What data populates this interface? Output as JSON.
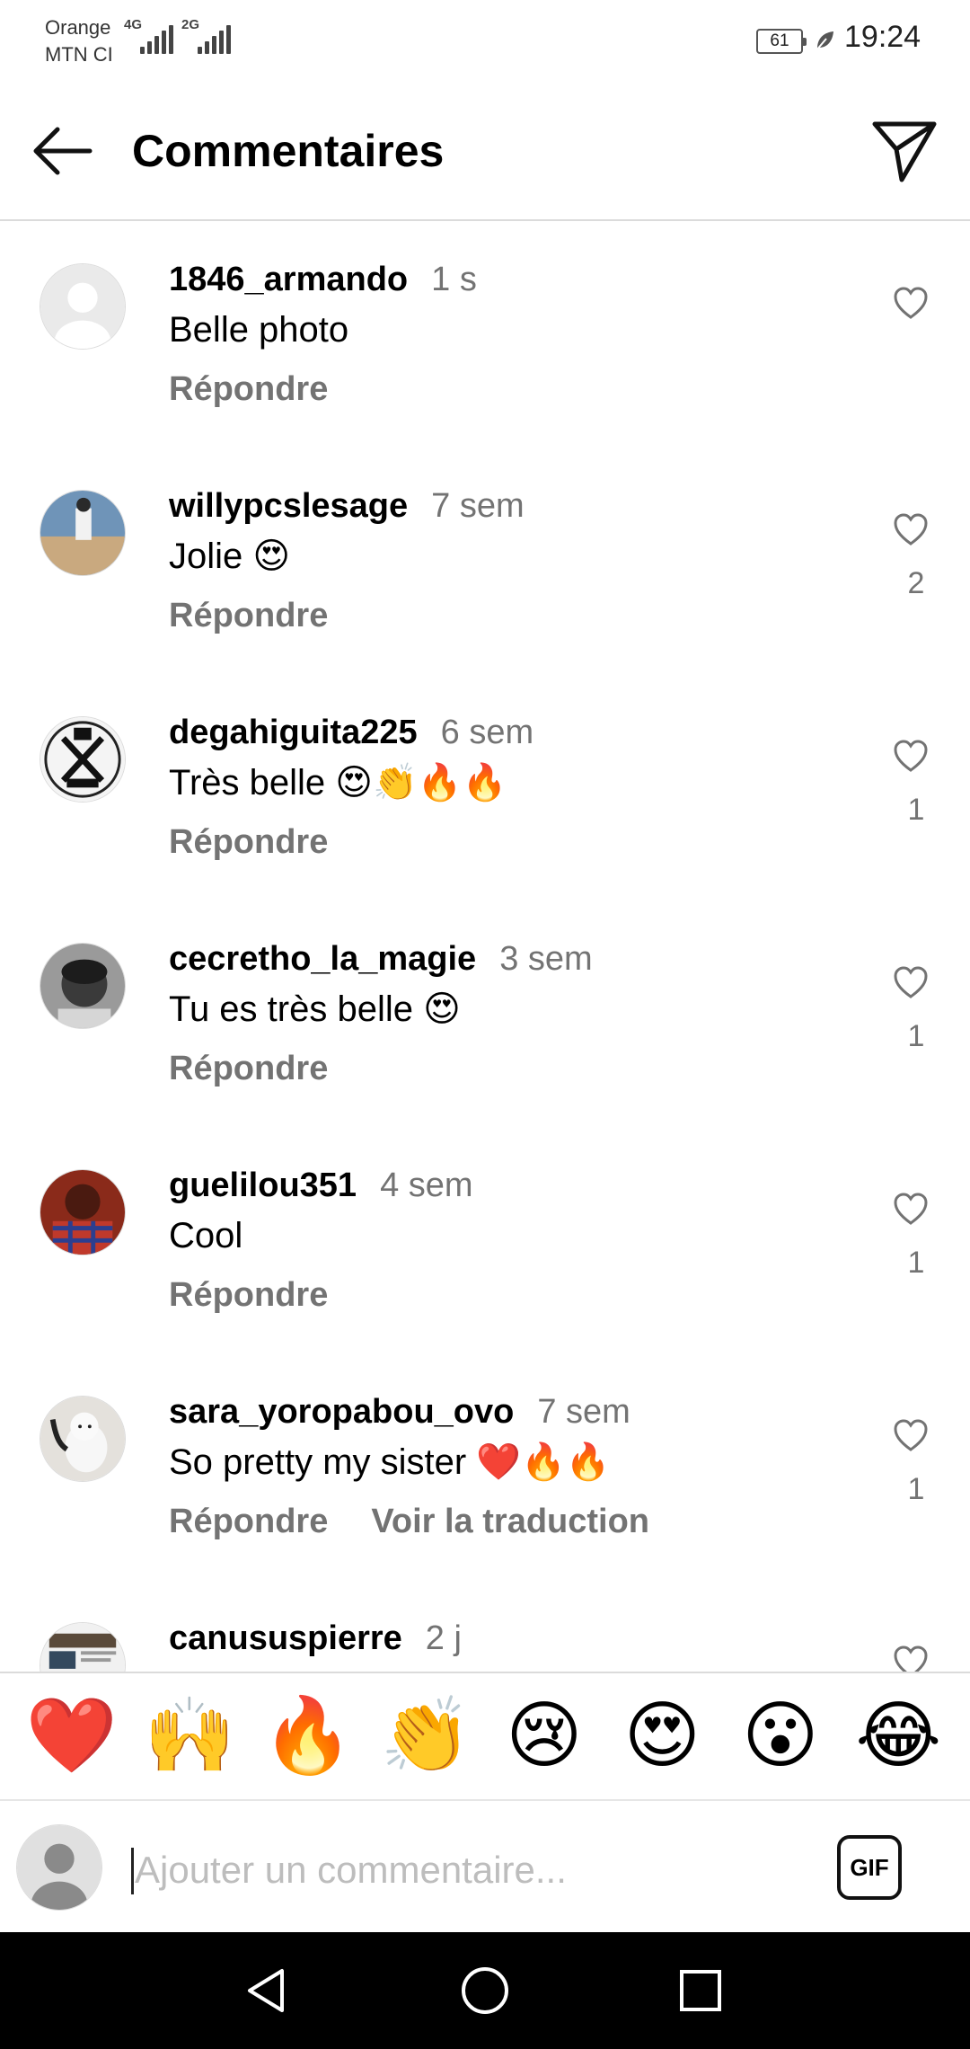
{
  "status_bar": {
    "carrier_1": "Orange",
    "carrier_2": "MTN CI",
    "network_1": "4G",
    "network_2": "2G",
    "battery": "61",
    "time": "19:24"
  },
  "header": {
    "title": "Commentaires",
    "back_icon": "arrow-left-icon",
    "send_icon": "paper-plane-icon"
  },
  "comments": [
    {
      "username": "1846_armando",
      "time": "1 s",
      "text": "Belle photo",
      "reply": "Répondre",
      "likes": ""
    },
    {
      "username": "willypcslesage",
      "time": "7 sem",
      "text": "Jolie 😍",
      "reply": "Répondre",
      "likes": "2"
    },
    {
      "username": "degahiguita225",
      "time": "6 sem",
      "text": "Très belle 😍👏🔥🔥",
      "reply": "Répondre",
      "likes": "1"
    },
    {
      "username": "cecretho_la_magie",
      "time": "3 sem",
      "text": "Tu es très belle 😍",
      "reply": "Répondre",
      "likes": "1"
    },
    {
      "username": "guelilou351",
      "time": "4 sem",
      "text": "Cool",
      "reply": "Répondre",
      "likes": "1"
    },
    {
      "username": "sara_yoropabou_ovo",
      "time": "7 sem",
      "text": "So pretty my sister ❤️🔥🔥",
      "reply": "Répondre",
      "translate": "Voir la traduction",
      "likes": "1"
    },
    {
      "username": "canususpierre",
      "time": "2 j",
      "text": "",
      "reply": "",
      "likes": ""
    }
  ],
  "emoji_bar": [
    "❤️",
    "🙌",
    "🔥",
    "👏",
    "😢",
    "😍",
    "😮",
    "😂"
  ],
  "input": {
    "placeholder": "Ajouter un commentaire...",
    "gif_label": "GIF"
  },
  "colors": {
    "secondary_text": "#737373",
    "divider": "#dbdbdb",
    "nav_bar": "#000000"
  }
}
